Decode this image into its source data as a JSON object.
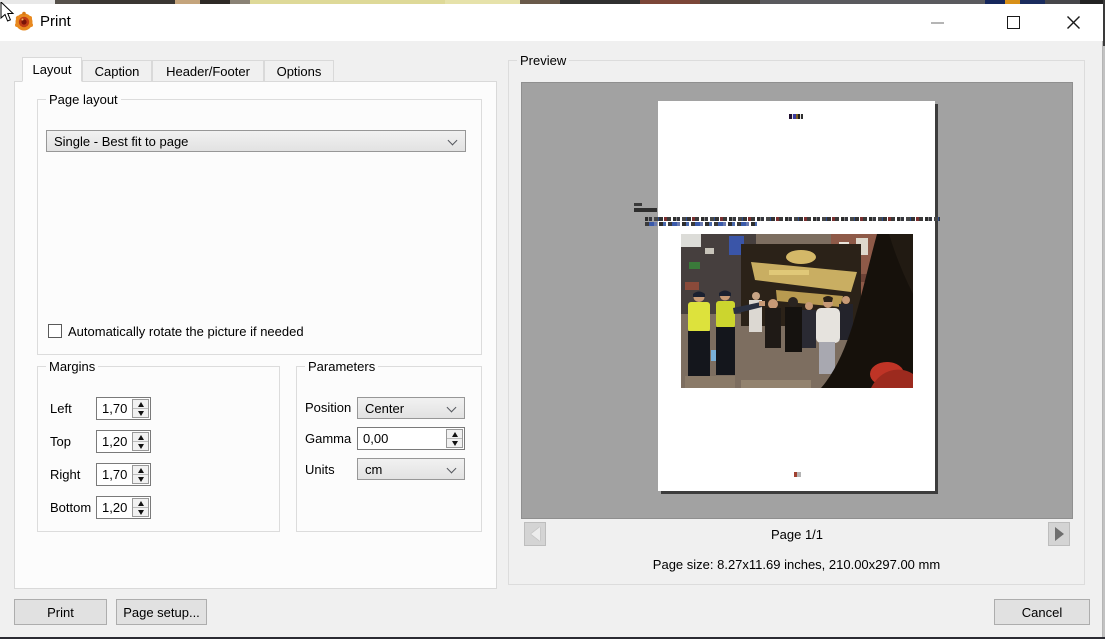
{
  "window": {
    "title": "Print"
  },
  "tabs": [
    {
      "label": "Layout",
      "active": true
    },
    {
      "label": "Caption",
      "active": false
    },
    {
      "label": "Header/Footer",
      "active": false
    },
    {
      "label": "Options",
      "active": false
    }
  ],
  "page_layout": {
    "group_label": "Page layout",
    "selected": "Single - Best fit to page"
  },
  "auto_rotate": {
    "label": "Automatically rotate the picture if needed",
    "checked": false
  },
  "margins": {
    "group_label": "Margins",
    "fields": [
      {
        "label": "Left",
        "value": "1,70"
      },
      {
        "label": "Top",
        "value": "1,20"
      },
      {
        "label": "Right",
        "value": "1,70"
      },
      {
        "label": "Bottom",
        "value": "1,20"
      }
    ]
  },
  "parameters": {
    "group_label": "Parameters",
    "position": {
      "label": "Position",
      "value": "Center"
    },
    "gamma": {
      "label": "Gamma",
      "value": "0,00"
    },
    "units": {
      "label": "Units",
      "value": "cm"
    }
  },
  "preview": {
    "group_label": "Preview",
    "page_indicator": "Page 1/1",
    "page_size": "Page size: 8.27x11.69 inches, 210.00x297.00 mm"
  },
  "footer": {
    "print_label": "Print",
    "page_setup_label": "Page setup...",
    "cancel_label": "Cancel"
  },
  "colors": {
    "dialog_bg": "#f0f0f0",
    "panel_bg": "#fcfcfc",
    "preview_bg": "#a2a2a2",
    "button_bg": "#e1e1e1",
    "button_border": "#adadad",
    "hivis_yellow": "#dde23c",
    "accent_red": "#bf3426"
  }
}
